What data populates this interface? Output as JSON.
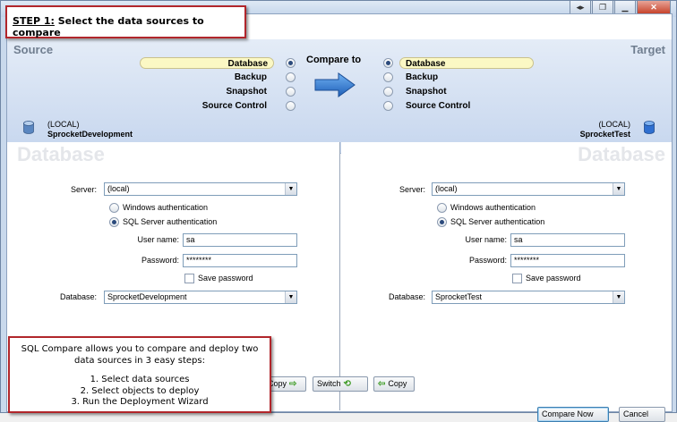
{
  "window": {
    "controls": [
      "restore-down",
      "restore",
      "minimize",
      "close"
    ]
  },
  "callout_top": {
    "step": "STEP 1:",
    "text": " Select the data sources to compare"
  },
  "source": {
    "title": "Source",
    "options": [
      "Database",
      "Backup",
      "Snapshot",
      "Source Control"
    ],
    "selected": "Database",
    "server_line": "(LOCAL)",
    "db_name": "SprocketDevelopment"
  },
  "target": {
    "title": "Target",
    "options": [
      "Database",
      "Backup",
      "Snapshot",
      "Source Control"
    ],
    "selected": "Database",
    "server_line": "(LOCAL)",
    "db_name": "SprocketTest"
  },
  "compare_to": "Compare to",
  "panel_left": {
    "watermark": "Database",
    "server_label": "Server:",
    "server_value": "(local)",
    "windows_auth": "Windows authentication",
    "sql_auth": "SQL Server authentication",
    "auth_selected": "sql",
    "username_label": "User name:",
    "username_value": "sa",
    "password_label": "Password:",
    "password_value": "********",
    "save_password": "Save password",
    "database_label": "Database:",
    "database_value": "SprocketDevelopment"
  },
  "panel_right": {
    "watermark": "Database",
    "server_label": "Server:",
    "server_value": "(local)",
    "windows_auth": "Windows authentication",
    "sql_auth": "SQL Server authentication",
    "auth_selected": "sql",
    "username_label": "User name:",
    "username_value": "sa",
    "password_label": "Password:",
    "password_value": "********",
    "save_password": "Save password",
    "database_label": "Database:",
    "database_value": "SprocketTest"
  },
  "buttons": {
    "copy_right": "Copy",
    "switch": "Switch",
    "copy_left": "Copy",
    "compare_now": "Compare Now",
    "cancel": "Cancel"
  },
  "callout_bottom": {
    "intro_line1": "SQL Compare allows you to compare and deploy two",
    "intro_line2": "data sources in 3 easy steps:",
    "step1": "1. Select data sources",
    "step2": "2. Select objects to deploy",
    "step3": "3. Run the Deployment Wizard"
  },
  "colors": {
    "accent_blue": "#2f78d4",
    "callout_border": "#b1262b",
    "selected_highlight": "#fbf8c4"
  }
}
